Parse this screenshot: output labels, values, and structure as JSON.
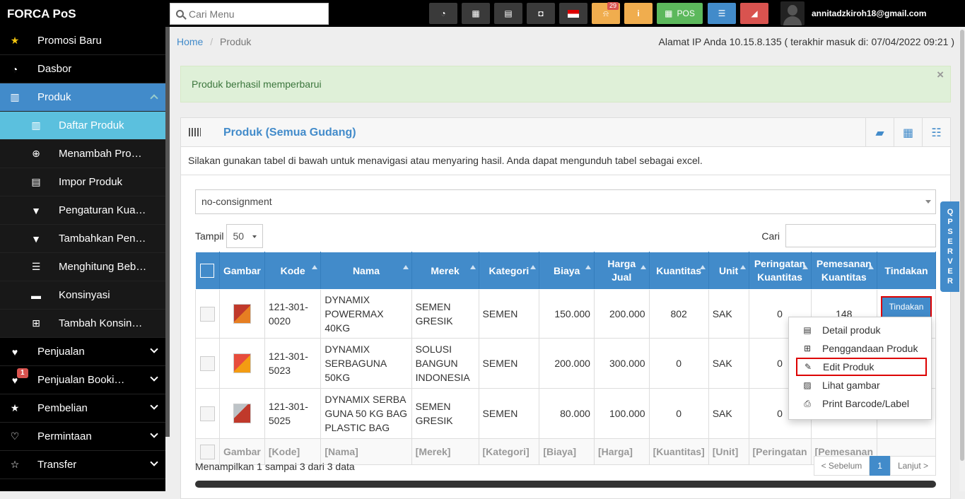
{
  "app": {
    "brand": "FORCA PoS",
    "search_placeholder": "Cari Menu",
    "user_email": "annitadzkiroh18@gmail.com",
    "toolbar": {
      "notification_count": "29",
      "pos_label": "POS"
    }
  },
  "colors": {
    "primary": "#428bca",
    "success_bg": "#dff0d8",
    "danger": "#d9534f",
    "sidebar_bg": "#000000",
    "sub_active": "#5bc0de"
  },
  "sidebar": {
    "items": [
      {
        "label": "Promosi Baru",
        "icon": "star-icon"
      },
      {
        "label": "Dasbor",
        "icon": "dashboard-icon"
      },
      {
        "label": "Produk",
        "icon": "barcode-icon"
      },
      {
        "label": "Daftar Produk",
        "icon": "barcode-icon"
      },
      {
        "label": "Menambah Produk",
        "icon": "plus-circle-icon"
      },
      {
        "label": "Impor Produk",
        "icon": "file-icon"
      },
      {
        "label": "Pengaturan Kuantitas",
        "icon": "filter-icon"
      },
      {
        "label": "Tambahkan Penyesuaian",
        "icon": "filter-icon"
      },
      {
        "label": "Menghitung Beban",
        "icon": "list-icon"
      },
      {
        "label": "Konsinyasi",
        "icon": "card-icon"
      },
      {
        "label": "Tambah Konsinyasi",
        "icon": "plus-square-icon"
      },
      {
        "label": "Penjualan",
        "icon": "heart-icon"
      },
      {
        "label": "Penjualan Booking",
        "icon": "heart-icon",
        "badge": "1"
      },
      {
        "label": "Pembelian",
        "icon": "star-icon"
      },
      {
        "label": "Permintaan",
        "icon": "heart-outline-icon"
      },
      {
        "label": "Transfer",
        "icon": "star-outline-icon"
      }
    ]
  },
  "breadcrumb": {
    "home": "Home",
    "current": "Produk"
  },
  "ip_info": "Alamat IP Anda 10.15.8.135 ( terakhir masuk di: 07/04/2022 09:21 )",
  "alert": {
    "message": "Produk berhasil memperbarui",
    "close": "×"
  },
  "panel": {
    "title": "Produk (Semua Gudang)",
    "intro": "Silakan gunakan tabel di bawah untuk menavigasi atau menyaring hasil. Anda dapat mengunduh tabel sebagai excel.",
    "filter_value": "no-consignment",
    "show_label": "Tampil",
    "show_value": "50",
    "search_label": "Cari"
  },
  "table": {
    "headers": [
      "Gambar",
      "Kode",
      "Nama",
      "Merek",
      "Kategori",
      "Biaya",
      "Harga Jual",
      "Kuantitas",
      "Unit",
      "Peringatan Kuantitas",
      "Pemesanan Kuantitas",
      "Tindakan"
    ],
    "rows": [
      {
        "kode": "121-301-0020",
        "nama": "DYNAMIX POWERMAX 40KG",
        "merek": "SEMEN GRESIK",
        "kategori": "SEMEN",
        "biaya": "150.000",
        "harga": "200.000",
        "qty": "802",
        "unit": "SAK",
        "peringatan": "0",
        "pemesanan": "148"
      },
      {
        "kode": "121-301-5023",
        "nama": "DYNAMIX SERBAGUNA 50KG",
        "merek": "SOLUSI BANGUN INDONESIA",
        "kategori": "SEMEN",
        "biaya": "200.000",
        "harga": "300.000",
        "qty": "0",
        "unit": "SAK",
        "peringatan": "0",
        "pemesanan": ""
      },
      {
        "kode": "121-301-5025",
        "nama": "DYNAMIX SERBA GUNA 50 KG BAG PLASTIC BAG",
        "merek": "SEMEN GRESIK",
        "kategori": "SEMEN",
        "biaya": "80.000",
        "harga": "100.000",
        "qty": "0",
        "unit": "SAK",
        "peringatan": "0",
        "pemesanan": ""
      }
    ],
    "footer": [
      "Gambar",
      "[Kode]",
      "[Nama]",
      "[Merek]",
      "[Kategori]",
      "[Biaya]",
      "[Harga]",
      "[Kuantitas]",
      "[Unit]",
      "[Peringatan",
      "[Pemesanan"
    ],
    "action_button": "Tindakan"
  },
  "dropdown": [
    "Detail produk",
    "Penggandaan Produk",
    "Edit Produk",
    "Lihat gambar",
    "Print Barcode/Label"
  ],
  "pagination": {
    "info": "Menampilkan 1 sampai 3 dari 3 data",
    "prev": "< Sebelum",
    "page": "1",
    "next": "Lanjut >"
  },
  "qp_server": "QP SERVER"
}
